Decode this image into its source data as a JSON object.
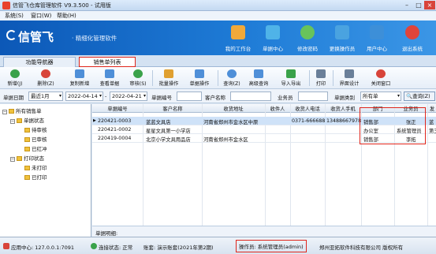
{
  "window": {
    "title": "信管飞仓库管理软件 V9.3.500 - 试用版"
  },
  "menu": [
    "系统(S)",
    "窗口(W)",
    "帮助(H)"
  ],
  "banner": {
    "logo": "信管飞",
    "slogan": "· 精细化管理软件",
    "buttons": [
      {
        "label": "我的工作台",
        "icon": "monitor-icon",
        "color": "#f0a93a"
      },
      {
        "label": "单据中心",
        "icon": "document-icon",
        "color": "#4fb3e8"
      },
      {
        "label": "修改密码",
        "icon": "key-icon",
        "color": "#68c35b"
      },
      {
        "label": "更换操作员",
        "icon": "users-icon",
        "color": "#4aa3e0"
      },
      {
        "label": "用户中心",
        "icon": "user-icon",
        "color": "#3d8fd8"
      },
      {
        "label": "退出系统",
        "icon": "power-icon",
        "color": "#e0443a"
      }
    ]
  },
  "tabs": [
    {
      "label": "功能导航器"
    },
    {
      "label": "销售单列表"
    }
  ],
  "toolbar": [
    {
      "label": "新增(J)",
      "icon": "add-icon",
      "color": "#3aa24a"
    },
    {
      "label": "删除(Z)",
      "icon": "delete-icon",
      "color": "#d8443a"
    },
    {
      "label": "复制新增",
      "icon": "copy-icon",
      "color": "#4f8fd8"
    },
    {
      "label": "查看单据",
      "icon": "view-icon",
      "color": "#4f8fd8"
    },
    {
      "label": "审核(S)",
      "icon": "approve-icon",
      "color": "#3aa24a"
    },
    {
      "label": "批量操作",
      "icon": "batch-icon",
      "color": "#e0a030"
    },
    {
      "label": "单据操作",
      "icon": "doc-ops-icon",
      "color": "#4f8fd8"
    },
    {
      "label": "查询(Z)",
      "icon": "query-icon",
      "color": "#4f8fd8"
    },
    {
      "label": "高级查询",
      "icon": "advanced-query-icon",
      "color": "#4f8fd8"
    },
    {
      "label": "导入导出",
      "icon": "import-export-icon",
      "color": "#3aa24a"
    },
    {
      "label": "打印",
      "icon": "print-icon",
      "color": "#6a7f99"
    },
    {
      "label": "界面设计",
      "icon": "design-icon",
      "color": "#6a7f99"
    },
    {
      "label": "关闭窗口",
      "icon": "close-window-icon",
      "color": "#d8443a"
    }
  ],
  "filter": {
    "date_label": "单据日期",
    "range": "最近1月",
    "from": "2022-04-14",
    "to_sep": "-",
    "to": "2022-04-21",
    "docno_label": "单据编号",
    "client_label": "客户名称",
    "salesman_label": "业务员",
    "type_label": "单据类别",
    "type_value": "所有单",
    "query_button": "查询(Z)"
  },
  "tree": {
    "root": "所有销售单",
    "groups": [
      {
        "label": "单据状态",
        "items": [
          "待审核",
          "已审核",
          "已红冲"
        ]
      },
      {
        "label": "打印状态",
        "items": [
          "未打印",
          "已打印"
        ]
      }
    ]
  },
  "grid": {
    "columns": [
      "单据编号",
      "客户名称",
      "收货地址",
      "收件人",
      "收货人电话",
      "收货人手机",
      "部门",
      "业务员",
      "发"
    ],
    "rows": [
      {
        "docno": "220421-0003",
        "client": "蓝蓝文具店",
        "address": "河南省郑州市金水区中原",
        "recipient": "",
        "phone": "0371-666688",
        "mobile": "13488667978",
        "dept": "销售部",
        "salesman": "张正",
        "extra": "蓝"
      },
      {
        "docno": "220421-0002",
        "client": "星星文具第一小学店",
        "address": "",
        "recipient": "",
        "phone": "",
        "mobile": "",
        "dept": "办公室",
        "salesman": "系统管理员",
        "extra": "第三"
      },
      {
        "docno": "220419-0004",
        "client": "北京小学文具用品店",
        "address": "河南省郑州市金水区",
        "recipient": "",
        "phone": "",
        "mobile": "",
        "dept": "销售部",
        "salesman": "李拓",
        "extra": ""
      }
    ]
  },
  "detail_label": "单据明细:",
  "statusbar": {
    "app_center": "应用中心: 127.0.0.1:7091",
    "conn": "连接状态: 正常",
    "account": "账套: 演示账套(2021年第2期)",
    "operator": "操作员: 系统管理员(admin)",
    "company": "郑州亚拓软件科技有限公司 版权所有"
  }
}
